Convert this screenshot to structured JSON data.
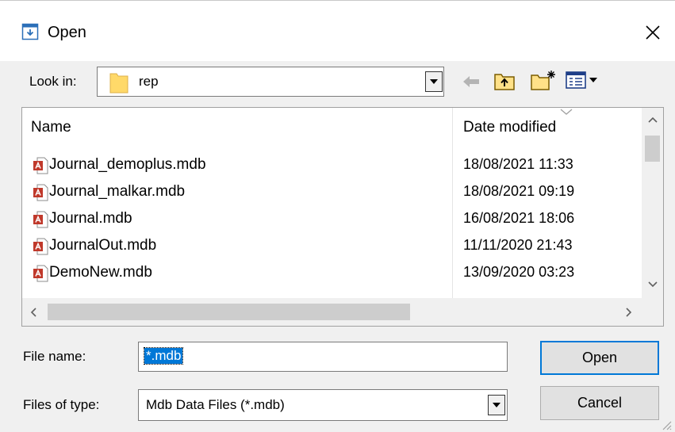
{
  "dialog": {
    "title": "Open",
    "look_in": {
      "label": "Look in:",
      "value": "rep"
    },
    "file_list": {
      "columns": {
        "name": "Name",
        "date": "Date modified"
      },
      "rows": [
        {
          "name": "Journal_demoplus.mdb",
          "date": "18/08/2021 11:33"
        },
        {
          "name": "Journal_malkar.mdb",
          "date": "18/08/2021 09:19"
        },
        {
          "name": "Journal.mdb",
          "date": "16/08/2021 18:06"
        },
        {
          "name": "JournalOut.mdb",
          "date": "11/11/2020 21:43"
        },
        {
          "name": "DemoNew.mdb",
          "date": "13/09/2020 03:23"
        }
      ]
    },
    "file_name": {
      "label": "File name:",
      "value": "*.mdb"
    },
    "file_type": {
      "label": "Files of type:",
      "value": "Mdb Data Files (*.mdb)"
    },
    "buttons": {
      "open": "Open",
      "cancel": "Cancel"
    }
  },
  "icons": {
    "title": "open-file-icon",
    "close": "close-icon",
    "folder": "folder-icon",
    "back": "back-arrow-icon",
    "up": "up-folder-icon",
    "new_folder": "new-folder-icon",
    "view": "view-menu-icon",
    "file": "access-database-file-icon"
  },
  "colors": {
    "selection": "#0078d7",
    "file_icon": "#c0392b",
    "folder": "#ffd969"
  }
}
